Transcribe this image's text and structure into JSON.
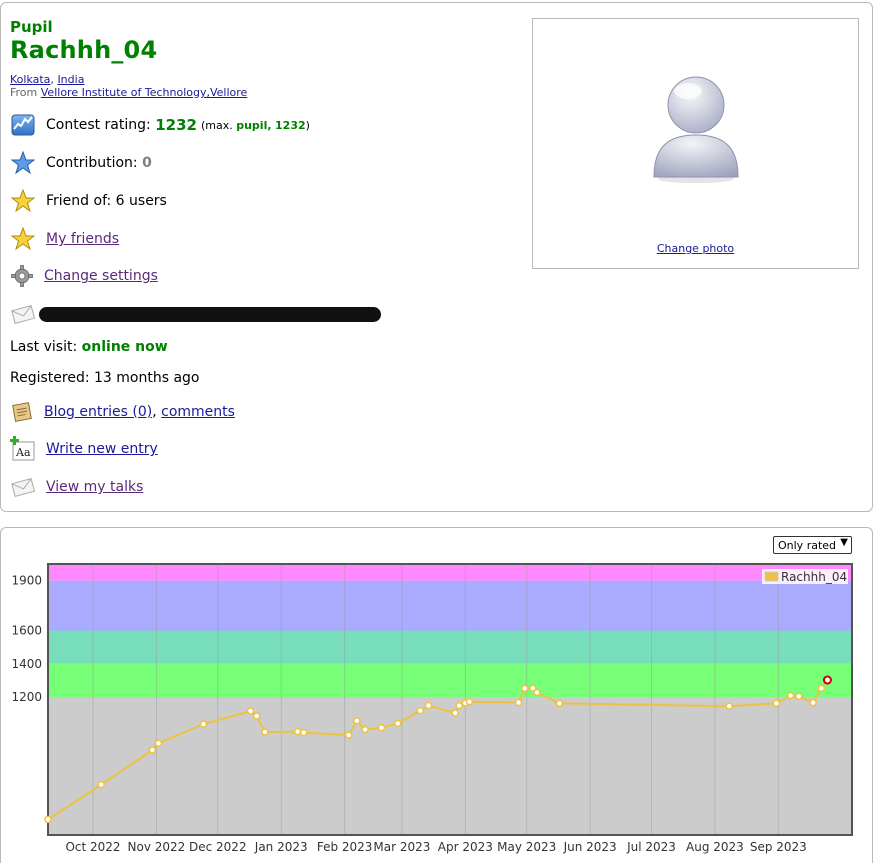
{
  "profile": {
    "rank": "Pupil",
    "handle": "Rachhh_04",
    "city": "Kolkata",
    "country": "India",
    "from_prefix": "From",
    "organization": "Vellore Institute of Technology,Vellore",
    "rating_label": "Contest rating:",
    "rating": "1232",
    "max_prefix": "(max.",
    "max_rank": "pupil,",
    "max_rating": "1232",
    "max_suffix": ")",
    "contribution_label": "Contribution:",
    "contribution": "0",
    "friend_of": "Friend of: 6 users",
    "my_friends": "My friends",
    "change_settings": "Change settings",
    "last_visit_label": "Last visit:",
    "last_visit": "online now",
    "registered": "Registered: 13 months ago",
    "blog_entries": "Blog entries (0)",
    "comma": ",",
    "comments": "comments",
    "write_entry": "Write new entry",
    "view_talks": "View my talks",
    "change_photo": "Change photo"
  },
  "chart_filter": {
    "selected": "Only rated"
  },
  "colors": {
    "rank_green": "#008000",
    "link": "#1a1a9a"
  },
  "chart_data": {
    "type": "line",
    "legend": "Rachhh_04",
    "legend_position": "top-right",
    "x_ticks": [
      "Oct 2022",
      "Nov 2022",
      "Dec 2022",
      "Jan 2023",
      "Feb 2023",
      "Mar 2023",
      "Apr 2023",
      "May 2023",
      "Jun 2023",
      "Jul 2023",
      "Aug 2023",
      "Sep 2023"
    ],
    "y_ticks": [
      1200,
      1400,
      1600,
      1900
    ],
    "ylim": [
      370,
      2000
    ],
    "xlim": [
      "2022-09-09",
      "2023-10-07"
    ],
    "bands": [
      {
        "from": 0,
        "to": 1200,
        "color": "#cccccc"
      },
      {
        "from": 1200,
        "to": 1400,
        "color": "#77ff77"
      },
      {
        "from": 1400,
        "to": 1600,
        "color": "#77ddbb"
      },
      {
        "from": 1600,
        "to": 1900,
        "color": "#aaaaff"
      },
      {
        "from": 1900,
        "to": 2000,
        "color": "#ff88ff"
      }
    ],
    "series": [
      {
        "name": "Rachhh_04",
        "color": "#edc240",
        "points": [
          {
            "x": "2022-09-09",
            "y": 464
          },
          {
            "x": "2022-10-05",
            "y": 673
          },
          {
            "x": "2022-10-30",
            "y": 881
          },
          {
            "x": "2022-11-02",
            "y": 922
          },
          {
            "x": "2022-11-24",
            "y": 1037
          },
          {
            "x": "2022-12-17",
            "y": 1116
          },
          {
            "x": "2022-12-20",
            "y": 1086
          },
          {
            "x": "2022-12-24",
            "y": 989
          },
          {
            "x": "2023-01-09",
            "y": 992
          },
          {
            "x": "2023-01-12",
            "y": 986
          },
          {
            "x": "2023-02-03",
            "y": 971
          },
          {
            "x": "2023-02-07",
            "y": 1057
          },
          {
            "x": "2023-02-11",
            "y": 1004
          },
          {
            "x": "2023-02-19",
            "y": 1015
          },
          {
            "x": "2023-02-27",
            "y": 1041
          },
          {
            "x": "2023-03-10",
            "y": 1118
          },
          {
            "x": "2023-03-14",
            "y": 1149
          },
          {
            "x": "2023-03-27",
            "y": 1104
          },
          {
            "x": "2023-03-29",
            "y": 1148
          },
          {
            "x": "2023-04-01",
            "y": 1164
          },
          {
            "x": "2023-04-03",
            "y": 1172
          },
          {
            "x": "2023-04-27",
            "y": 1167
          },
          {
            "x": "2023-04-30",
            "y": 1252
          },
          {
            "x": "2023-05-04",
            "y": 1253
          },
          {
            "x": "2023-05-06",
            "y": 1227
          },
          {
            "x": "2023-05-17",
            "y": 1162
          },
          {
            "x": "2023-08-08",
            "y": 1145
          },
          {
            "x": "2023-08-31",
            "y": 1162
          },
          {
            "x": "2023-09-07",
            "y": 1209
          },
          {
            "x": "2023-09-11",
            "y": 1204
          },
          {
            "x": "2023-09-18",
            "y": 1166
          },
          {
            "x": "2023-09-22",
            "y": 1252
          },
          {
            "x": "2023-09-25",
            "y": 1302
          }
        ]
      }
    ]
  }
}
